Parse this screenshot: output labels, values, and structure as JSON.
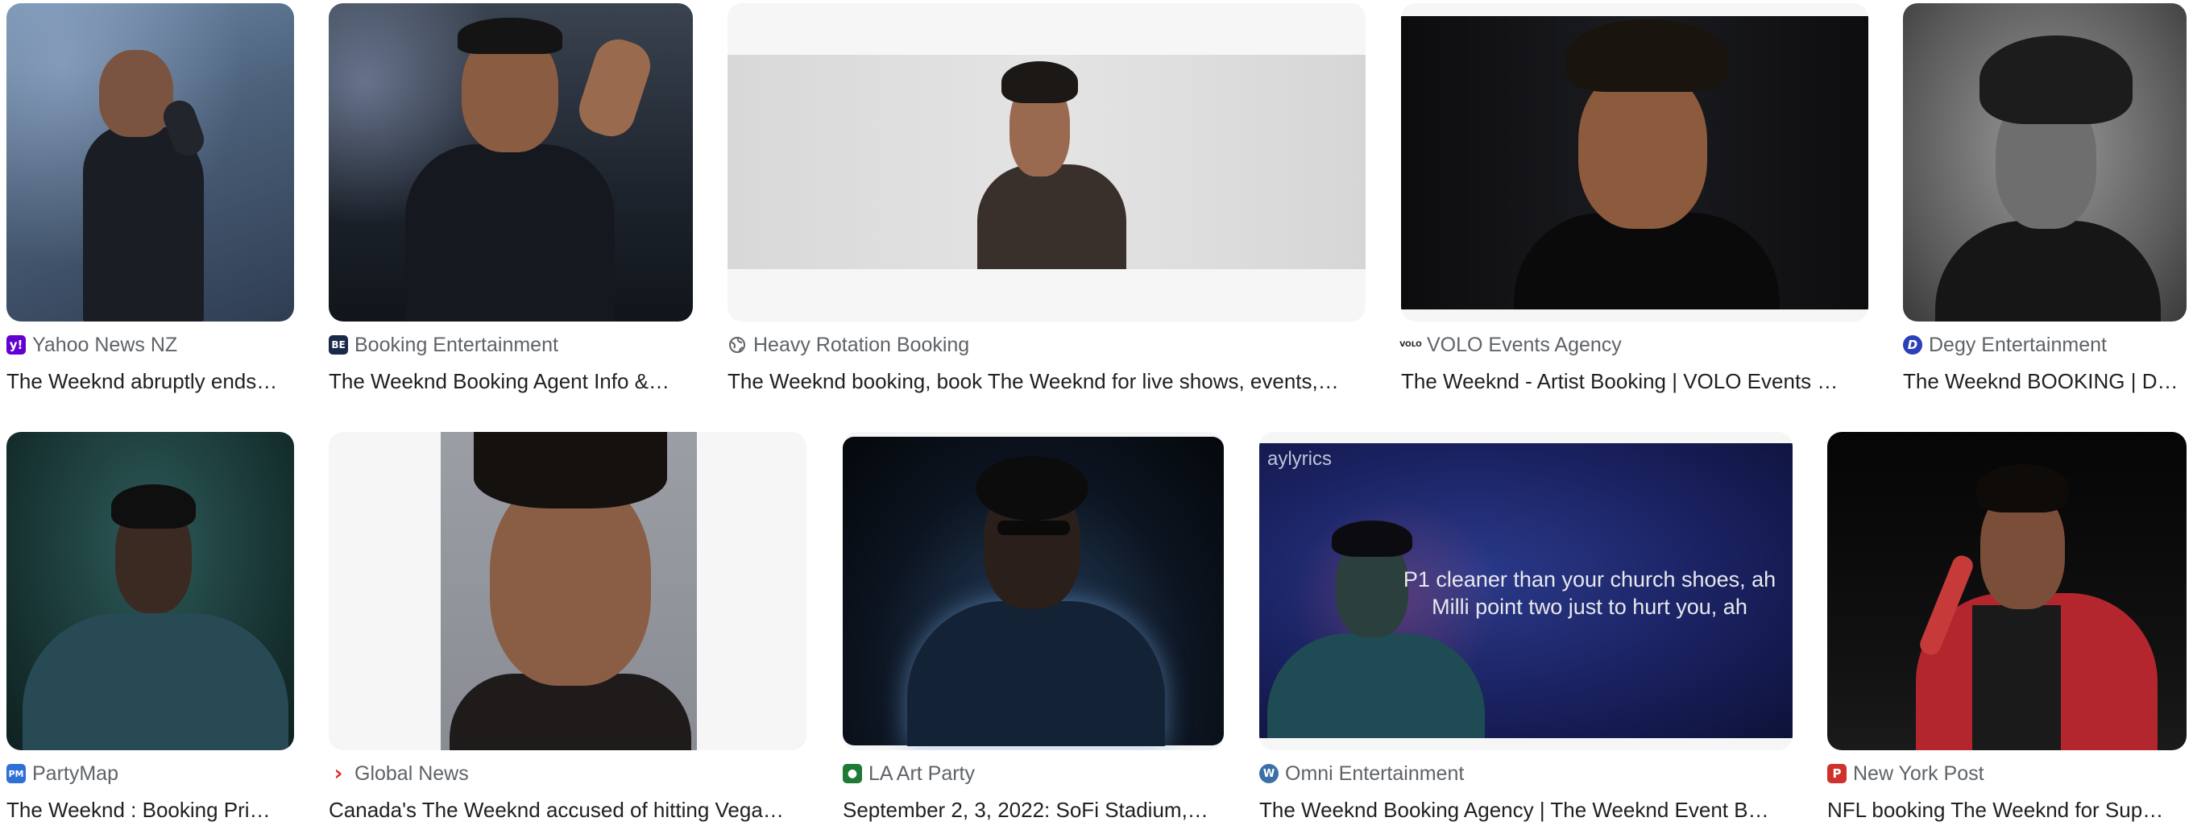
{
  "results": [
    {
      "source": "Yahoo News NZ",
      "title": "The Weeknd abruptly ends…",
      "favicon": "yahoo-icon",
      "fav_text": "y!",
      "fav_color": "#6001d2"
    },
    {
      "source": "Booking Entertainment",
      "title": "The Weeknd Booking Agent Info &…",
      "favicon": "booking-entertainment-icon",
      "fav_text": "BE",
      "fav_color": "#1c2a4a"
    },
    {
      "source": "Heavy Rotation Booking",
      "title": "The Weeknd booking, book The Weeknd for live shows, events,…",
      "favicon": "globe-icon",
      "fav_text": "",
      "fav_color": "#5f6368"
    },
    {
      "source": "VOLO Events Agency",
      "title": "The Weeknd - Artist Booking | VOLO Events …",
      "favicon": "volo-icon",
      "fav_text": "VOLO",
      "fav_color": "#222222"
    },
    {
      "source": "Degy Entertainment",
      "title": "The Weeknd BOOKING | D…",
      "favicon": "degy-icon",
      "fav_text": "D",
      "fav_color": "#2b3fb8"
    },
    {
      "source": "PartyMap",
      "title": "The Weeknd : Booking Pri…",
      "favicon": "partymap-icon",
      "fav_text": "PM",
      "fav_color": "#2f6fd6"
    },
    {
      "source": "Global News",
      "title": "Canada's The Weeknd accused of hitting Vega…",
      "favicon": "global-news-icon",
      "fav_text": "›",
      "fav_color": "#e22b2b"
    },
    {
      "source": "LA Art Party",
      "title": "September 2, 3, 2022: SoFi Stadium,…",
      "favicon": "la-art-party-icon",
      "fav_text": "●",
      "fav_color": "#1e7a34"
    },
    {
      "source": "Omni Entertainment",
      "title": "The Weeknd Booking Agency | The Weeknd Event B…",
      "favicon": "wordpress-icon",
      "fav_text": "W",
      "fav_color": "#3c6fa8"
    },
    {
      "source": "New York Post",
      "title": "NFL booking The Weeknd for Sup…",
      "favicon": "new-york-post-icon",
      "fav_text": "P",
      "fav_color": "#d0312d"
    }
  ],
  "overlays": {
    "watermark": "aylyrics",
    "lyric_line_1": "P1 cleaner than your church shoes, ah",
    "lyric_line_2": "Milli point two just to hurt you, ah"
  }
}
